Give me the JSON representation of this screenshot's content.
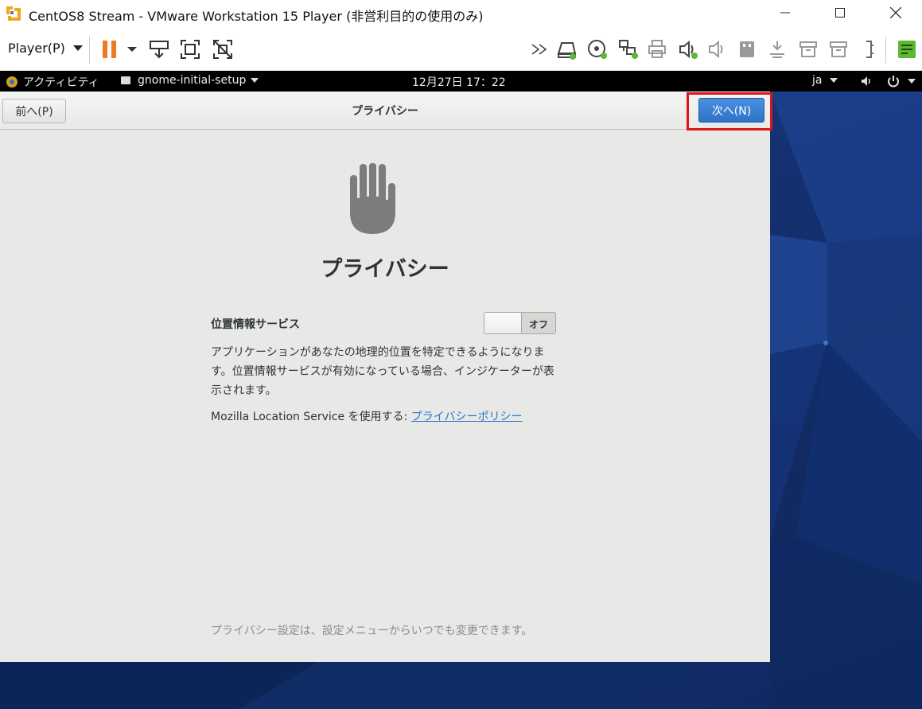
{
  "window": {
    "title": "CentOS8 Stream - VMware Workstation 15 Player (非営利目的の使用のみ)"
  },
  "toolbar": {
    "player_menu_label": "Player(P)",
    "icons": [
      "pause-icon",
      "send-ctrl-alt-del-icon",
      "fullscreen-icon",
      "unity-icon",
      "more-icon",
      "hard-disk-icon",
      "cd-dvd-icon",
      "network-adapter-icon",
      "printer-icon",
      "sound-icon",
      "sound-muted-icon",
      "usb-icon",
      "bluetooth-icon",
      "archive-icon",
      "archive-icon",
      "display-icon",
      "notes-icon"
    ]
  },
  "gnome_bar": {
    "activities": "アクティビティ",
    "app_menu": "gnome-initial-setup",
    "clock": "12月27日  17：22",
    "language": "ja"
  },
  "setup": {
    "back_label": "前へ(P)",
    "header_title": "プライバシー",
    "next_label": "次へ(N)",
    "page_title": "プライバシー",
    "location_label": "位置情報サービス",
    "toggle_state_label": "オフ",
    "toggle_on": false,
    "description": "アプリケーションがあなたの地理的位置を特定できるようになります。位置情報サービスが有効になっている場合、インジケーターが表示されます。",
    "mozilla_prefix": "Mozilla Location Service を使用する: ",
    "privacy_link": "プライバシーポリシー",
    "footer_note": "プライバシー設定は、設定メニューからいつでも変更できます。"
  },
  "colors": {
    "highlight": "#e0141c",
    "next_button": "#3b82d6",
    "link": "#2a76c6",
    "pause": "#f07b1f"
  }
}
